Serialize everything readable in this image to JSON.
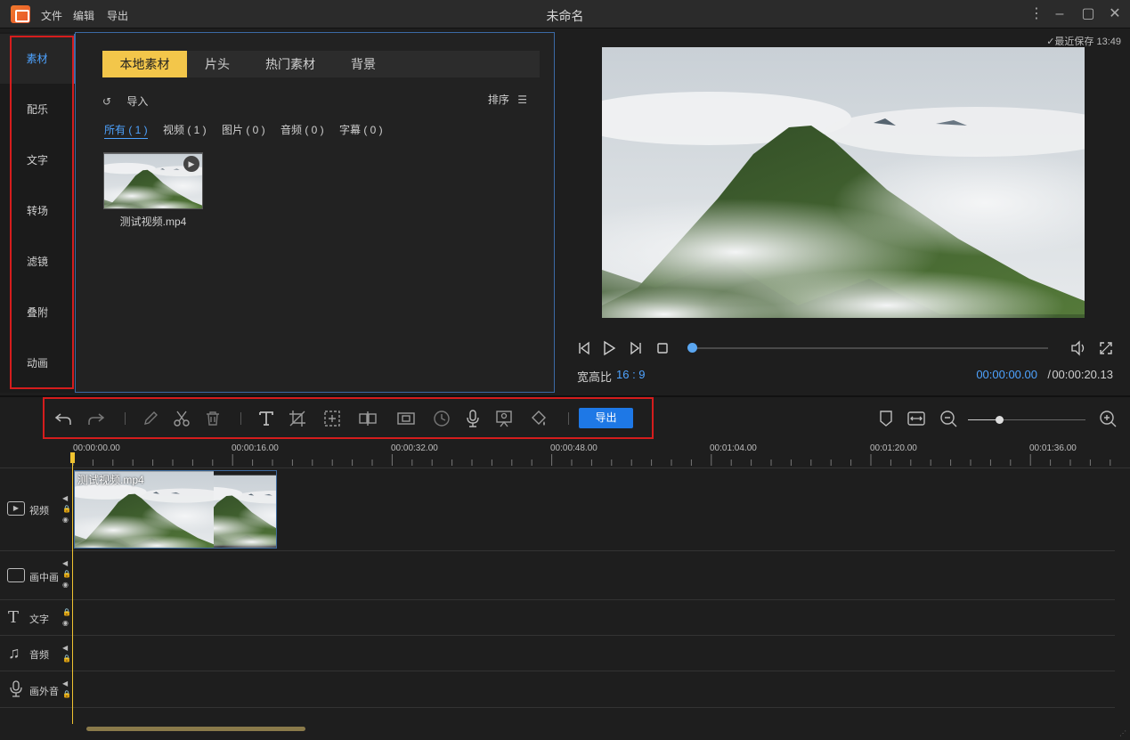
{
  "window": {
    "title": "未命名",
    "menu": [
      "文件",
      "编辑",
      "导出"
    ]
  },
  "leftnav": {
    "items": [
      "素材",
      "配乐",
      "文字",
      "转场",
      "滤镜",
      "叠附",
      "动画"
    ],
    "active": "素材"
  },
  "media": {
    "tabs": [
      "本地素材",
      "片头",
      "热门素材",
      "背景"
    ],
    "import_label": "导入",
    "sort_label": "排序",
    "filters": [
      "所有 ( 1 )",
      "视频 ( 1 )",
      "图片 ( 0 )",
      "音频 ( 0 )",
      "字幕 ( 0 )"
    ],
    "file_name": "测试视频.mp4"
  },
  "preview": {
    "saved": "最近保存 13:49",
    "ratio_label": "宽高比",
    "ratio_value": "16 : 9",
    "time_current": "00:00:00.00",
    "time_sep": "/",
    "time_total": "00:00:20.13"
  },
  "toolbar": {
    "export_label": "导出",
    "tools": [
      "undo-icon",
      "redo-icon",
      "edit-icon",
      "cut-icon",
      "delete-icon",
      "text-icon",
      "crop-icon",
      "mosaic-icon",
      "split-icon",
      "freeze-icon",
      "speed-icon",
      "voice-icon",
      "screen-record-icon",
      "color-icon"
    ]
  },
  "timeline": {
    "ticks": [
      "00:00:00.00",
      "00:00:16.00",
      "00:00:32.00",
      "00:00:48.00",
      "00:01:04.00",
      "00:01:20.00",
      "00:01:36.00"
    ],
    "tracks": [
      "视频",
      "画中画",
      "文字",
      "音频",
      "画外音"
    ],
    "clip_name": "测试视频.mp4"
  },
  "colors": {
    "accent": "#4ea3ff",
    "tab_active": "#f3c64a",
    "export_button": "#1e78e6",
    "playhead": "#f0c330",
    "highlight_box": "#d51d1d"
  }
}
